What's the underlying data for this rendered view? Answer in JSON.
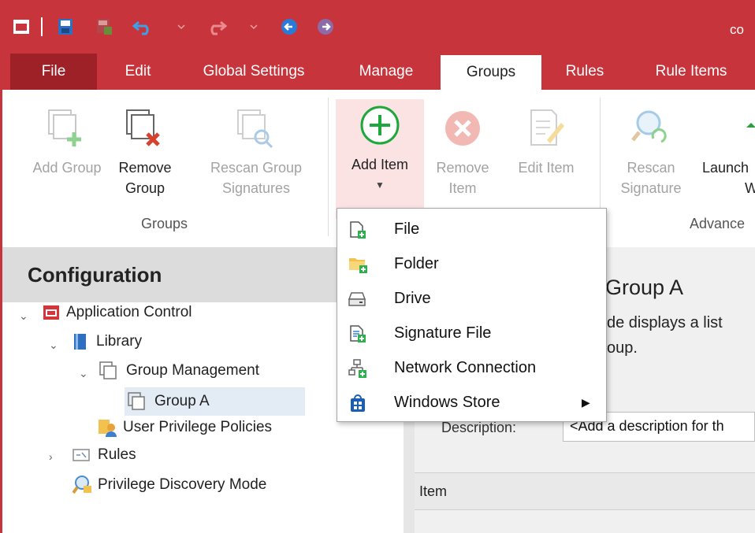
{
  "app": {
    "title_partial": "co"
  },
  "tabs": [
    "File",
    "Edit",
    "Global Settings",
    "Manage",
    "Groups",
    "Rules",
    "Rule Items"
  ],
  "active_tab": "Groups",
  "ribbon": {
    "groups_group": {
      "label": "Groups",
      "add_group": "Add Group",
      "remove_group_l1": "Remove",
      "remove_group_l2": "Group",
      "rescan_l1": "Rescan Group",
      "rescan_l2": "Signatures"
    },
    "items_group": {
      "add_item": "Add Item",
      "remove_item_l1": "Remove",
      "remove_item_l2": "Item",
      "edit_item": "Edit Item"
    },
    "advanced_group": {
      "label": "Advance",
      "rescan_sig_l1": "Rescan",
      "rescan_sig_l2": "Signature",
      "launch_l1": "Launch",
      "launch_l2": "W"
    }
  },
  "dropdown": {
    "items": [
      "File",
      "Folder",
      "Drive",
      "Signature File",
      "Network Connection",
      "Windows Store"
    ]
  },
  "tree": {
    "header": "Configuration",
    "nodes": [
      "Application Control",
      "Library",
      "Group Management",
      "Group A",
      "User Privilege Policies",
      "Rules",
      "Privilege Discovery Mode"
    ]
  },
  "details": {
    "title": "Group A",
    "desc_l1": "de displays a list",
    "desc_l2": "oup.",
    "description_label": "Description:",
    "description_value": "<Add a description for th",
    "column_item": "Item"
  },
  "colors": {
    "brand": "#c8343b",
    "add_green": "#2bb24c",
    "remove_red": "#e05a4f"
  }
}
